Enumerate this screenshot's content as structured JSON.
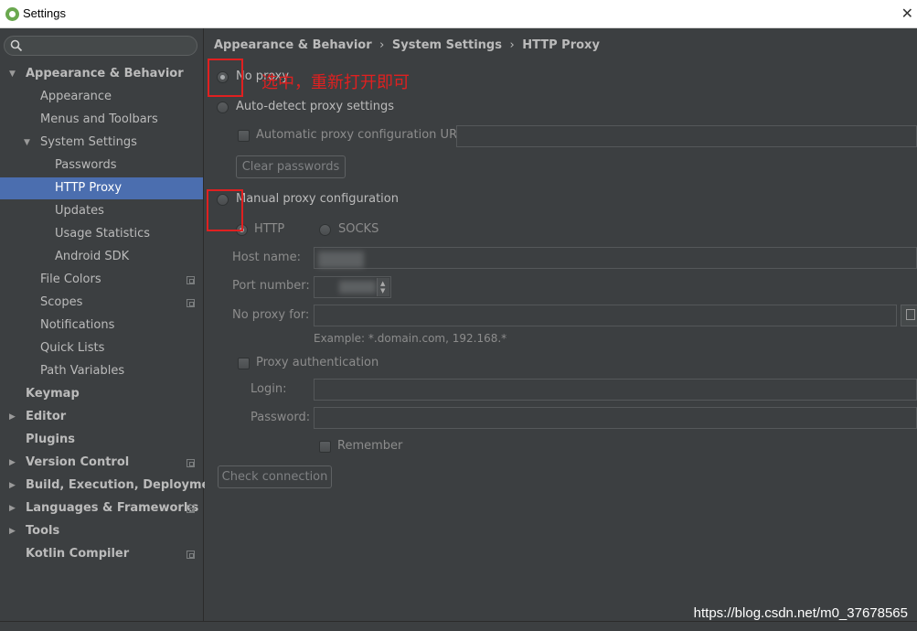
{
  "window": {
    "title": "Settings",
    "close_glyph": "✕"
  },
  "search": {
    "placeholder": ""
  },
  "sidebar": {
    "items": [
      {
        "label": "Appearance & Behavior",
        "bold": true
      },
      {
        "label": "Appearance"
      },
      {
        "label": "Menus and Toolbars"
      },
      {
        "label": "System Settings"
      },
      {
        "label": "Passwords"
      },
      {
        "label": "HTTP Proxy",
        "selected": true
      },
      {
        "label": "Updates"
      },
      {
        "label": "Usage Statistics"
      },
      {
        "label": "Android SDK"
      },
      {
        "label": "File Colors"
      },
      {
        "label": "Scopes"
      },
      {
        "label": "Notifications"
      },
      {
        "label": "Quick Lists"
      },
      {
        "label": "Path Variables"
      },
      {
        "label": "Keymap",
        "bold": true
      },
      {
        "label": "Editor",
        "bold": true
      },
      {
        "label": "Plugins",
        "bold": true
      },
      {
        "label": "Version Control",
        "bold": true
      },
      {
        "label": "Build, Execution, Deployment",
        "bold": true
      },
      {
        "label": "Languages & Frameworks",
        "bold": true
      },
      {
        "label": "Tools",
        "bold": true
      },
      {
        "label": "Kotlin Compiler",
        "bold": true
      }
    ]
  },
  "breadcrumb": {
    "parts": [
      "Appearance & Behavior",
      "System Settings",
      "HTTP Proxy"
    ],
    "separator": "›"
  },
  "proxy": {
    "no_proxy_label": "No proxy",
    "auto_detect_label": "Auto-detect proxy settings",
    "auto_config_url_label": "Automatic proxy configuration URL:",
    "clear_passwords_label": "Clear passwords",
    "manual_label": "Manual proxy configuration",
    "http_label": "HTTP",
    "socks_label": "SOCKS",
    "host_label": "Host name:",
    "port_label": "Port number:",
    "no_proxy_for_label": "No proxy for:",
    "example_text": "Example: *.domain.com, 192.168.*",
    "proxy_auth_label": "Proxy authentication",
    "login_label": "Login:",
    "password_label": "Password:",
    "remember_label": "Remember",
    "check_connection_label": "Check connection",
    "selected_option": "No proxy",
    "selected_protocol": "HTTP"
  },
  "annotation": {
    "text": "选中，重新打开即可",
    "color": "#e02020"
  },
  "watermark": "https://blog.csdn.net/m0_37678565",
  "colors": {
    "background": "#3c3f41",
    "selection": "#4b6eaf",
    "text": "#bbbbbb"
  }
}
